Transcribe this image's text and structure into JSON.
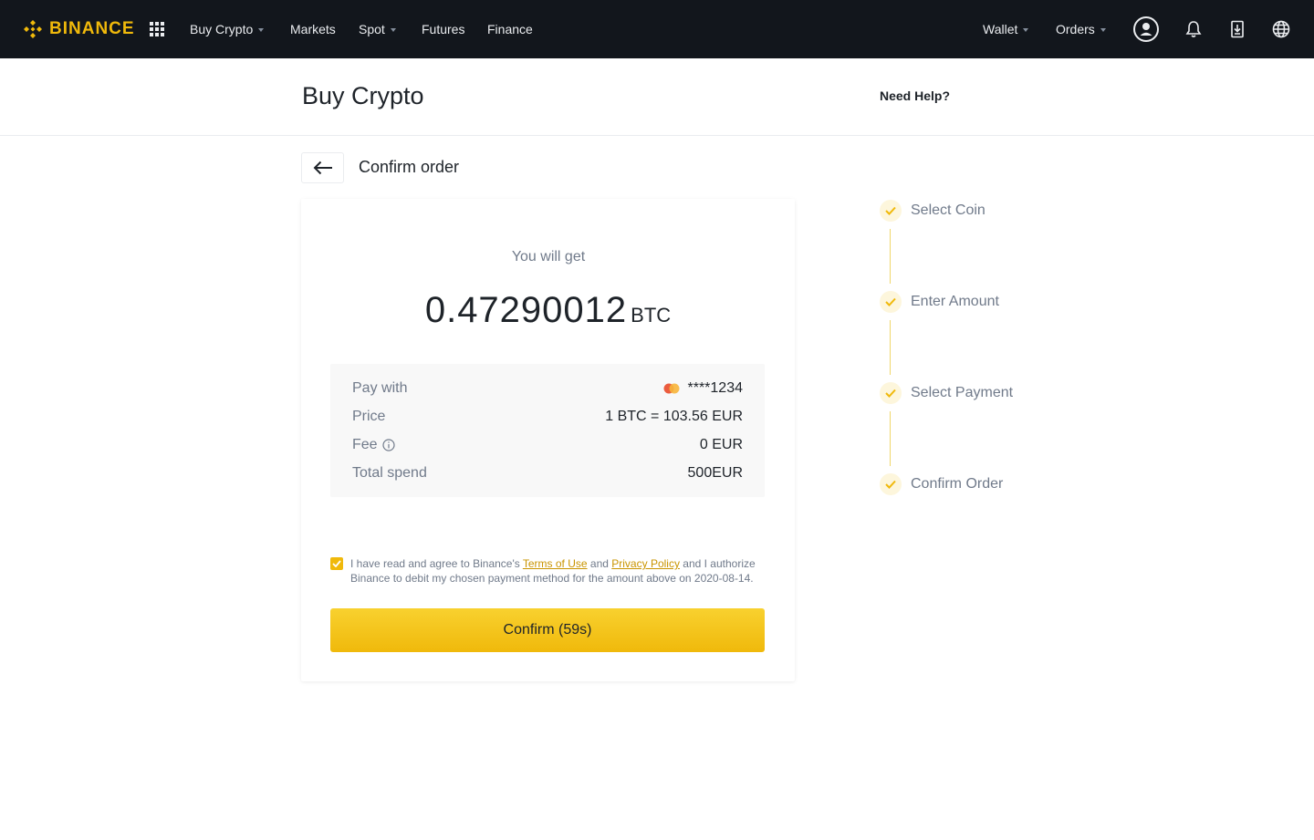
{
  "brand": {
    "name": "BINANCE",
    "color": "#f0b90b"
  },
  "nav": {
    "items": [
      {
        "label": "Buy Crypto",
        "has_caret": true
      },
      {
        "label": "Markets",
        "has_caret": false
      },
      {
        "label": "Spot",
        "has_caret": true
      },
      {
        "label": "Futures",
        "has_caret": false
      },
      {
        "label": "Finance",
        "has_caret": false
      }
    ],
    "right": [
      {
        "label": "Wallet",
        "has_caret": true
      },
      {
        "label": "Orders",
        "has_caret": true
      }
    ],
    "icons": [
      "apps-grid-icon",
      "user-icon",
      "bell-icon",
      "download-icon",
      "globe-icon"
    ]
  },
  "header": {
    "title": "Buy Crypto",
    "help": "Need Help?"
  },
  "order": {
    "heading": "Confirm order",
    "you_will_get": "You will get",
    "amount": "0.47290012",
    "unit": "BTC",
    "details": [
      {
        "label": "Pay with",
        "value": "****1234"
      },
      {
        "label": "Price",
        "value": "1 BTC = 103.56 EUR"
      },
      {
        "label": "Fee",
        "value": "0 EUR"
      },
      {
        "label": "Total spend",
        "value": "500EUR"
      }
    ],
    "agreement": {
      "checked": true,
      "text_1": "I have read and agree to Binance's ",
      "terms": "Terms of Use",
      "text_2": " and ",
      "privacy": "Privacy Policy",
      "text_3": " and I authorize Binance to debit my chosen payment method for the amount above on 2020-08-14."
    },
    "confirm_label": "Confirm (59s)"
  },
  "steps": [
    {
      "label": "Select Coin",
      "done": true
    },
    {
      "label": "Enter Amount",
      "done": true
    },
    {
      "label": "Select Payment",
      "done": true
    },
    {
      "label": "Confirm Order",
      "done": true
    }
  ]
}
